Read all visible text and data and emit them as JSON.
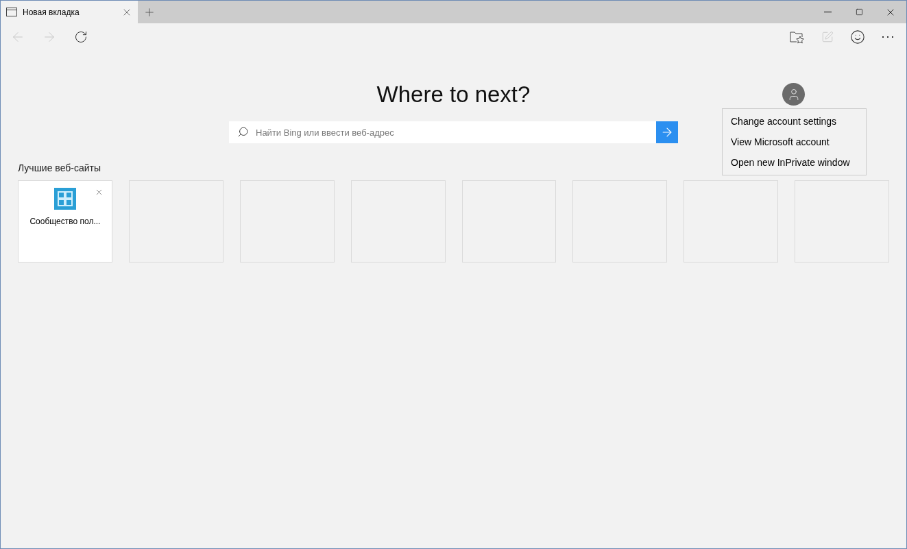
{
  "tab": {
    "title": "Новая вкладка",
    "selected": true
  },
  "toolbar": {
    "back": {
      "disabled": true
    },
    "forward": {
      "disabled": true
    },
    "reading_view": {
      "disabled": true
    }
  },
  "heading": "Where to next?",
  "search": {
    "placeholder": "Найти Bing или ввести веб-адрес"
  },
  "account_menu": {
    "expanded": true,
    "items": [
      "Change account settings",
      "View Microsoft account",
      "Open new InPrivate window"
    ]
  },
  "top_sites": {
    "title": "Лучшие веб-сайты",
    "tiles": [
      {
        "kind": "site",
        "title": "Сообщество пол..."
      },
      {
        "kind": "empty"
      },
      {
        "kind": "empty"
      },
      {
        "kind": "empty"
      },
      {
        "kind": "empty"
      },
      {
        "kind": "empty"
      },
      {
        "kind": "empty"
      },
      {
        "kind": "empty"
      }
    ]
  }
}
